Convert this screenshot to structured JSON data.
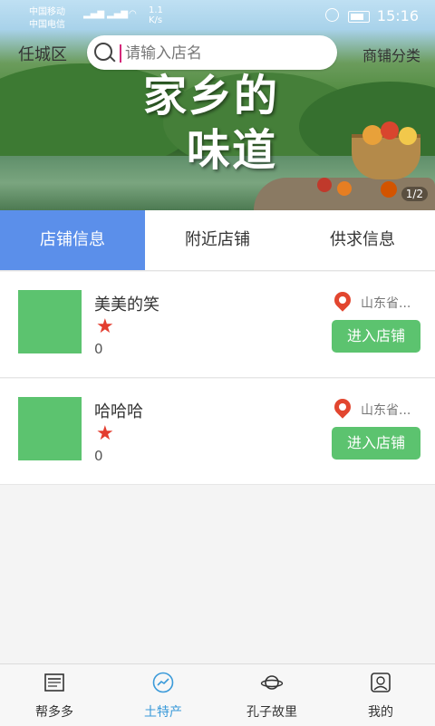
{
  "status_bar": {
    "carrier_1": "中国移动",
    "carrier_2": "中国电信",
    "net_speed": "1.1 K/s",
    "time": "15:16"
  },
  "header": {
    "location": "任城区",
    "search_placeholder": "请输入店名",
    "category_button": "商铺分类"
  },
  "banner": {
    "title_line1": "家乡的",
    "title_line2": "味道",
    "pager": "1/2"
  },
  "tabs": [
    {
      "label": "店铺信息",
      "active": true
    },
    {
      "label": "附近店铺",
      "active": false
    },
    {
      "label": "供求信息",
      "active": false
    }
  ],
  "shops": [
    {
      "name": "美美的笑",
      "rating_icon": "star-icon",
      "count": "0",
      "address": "山东省...",
      "enter_label": "进入店铺"
    },
    {
      "name": "哈哈哈",
      "rating_icon": "star-icon",
      "count": "0",
      "address": "山东省...",
      "enter_label": "进入店铺"
    }
  ],
  "bottom_nav": [
    {
      "label": "帮多多",
      "icon": "news-icon",
      "active": false
    },
    {
      "label": "土特产",
      "icon": "trend-icon",
      "active": true
    },
    {
      "label": "孔子故里",
      "icon": "planet-icon",
      "active": false
    },
    {
      "label": "我的",
      "icon": "profile-icon",
      "active": false
    }
  ],
  "colors": {
    "tab_active": "#5b8fea",
    "button_green": "#5cc36f",
    "star_red": "#e33d2f",
    "nav_active": "#3a9ad9"
  }
}
